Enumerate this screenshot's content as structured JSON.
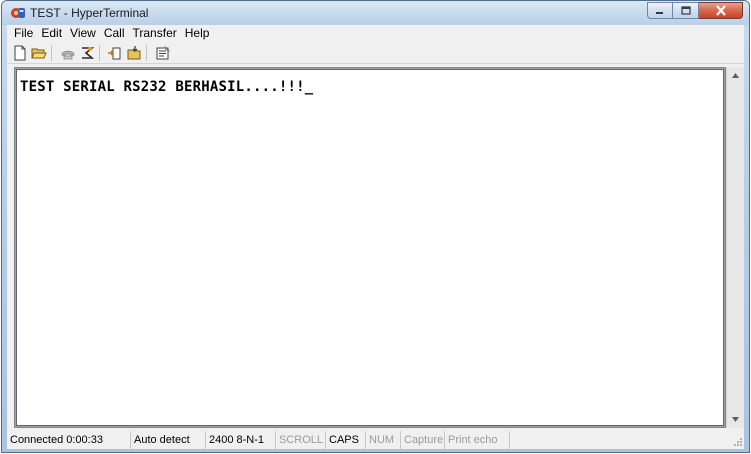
{
  "window": {
    "title": "TEST - HyperTerminal",
    "app_icon": "hyperterminal-icon",
    "controls": [
      "minimize-icon",
      "maximize-icon",
      "close-icon"
    ]
  },
  "menu": {
    "items": [
      "File",
      "Edit",
      "View",
      "Call",
      "Transfer",
      "Help"
    ]
  },
  "toolbar": {
    "buttons": [
      "new-file-icon",
      "open-folder-icon",
      "disconnect-phone-icon",
      "call-phone-icon",
      "send-icon",
      "receive-icon",
      "properties-icon"
    ]
  },
  "terminal": {
    "text": "TEST SERIAL RS232 BERHASIL....!!!_"
  },
  "status": {
    "connected": "Connected 0:00:33",
    "detect": "Auto detect",
    "port": "2400 8-N-1",
    "scroll": "SCROLL",
    "caps": "CAPS",
    "num": "NUM",
    "capture": "Capture",
    "print_echo": "Print echo"
  },
  "colors": {
    "titlebar": "#c8dbee",
    "terminal_bg": "#ffffff",
    "terminal_text": "#000000",
    "close_button": "#c6452a"
  }
}
